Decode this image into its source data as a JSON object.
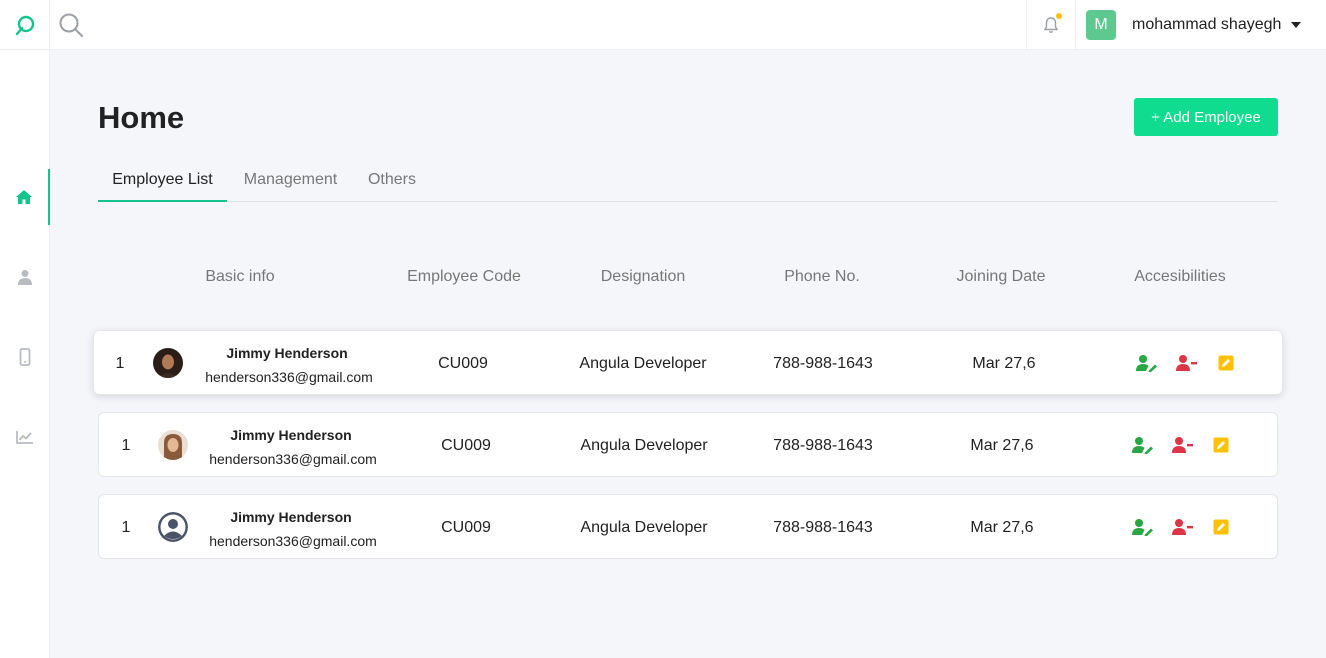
{
  "header": {
    "user": {
      "initial": "M",
      "name": "mohammad shayegh"
    }
  },
  "sidebar": {
    "items": [
      {
        "name": "home",
        "active": true
      },
      {
        "name": "user",
        "active": false
      },
      {
        "name": "mobile",
        "active": false
      },
      {
        "name": "chart",
        "active": false
      }
    ]
  },
  "main": {
    "title": "Home",
    "add_button": "+ Add Employee",
    "tabs": [
      {
        "label": "Employee List",
        "active": true
      },
      {
        "label": "Management",
        "active": false
      },
      {
        "label": "Others",
        "active": false
      }
    ],
    "columns": [
      "Basic info",
      "Employee Code",
      "Designation",
      "Phone No.",
      "Joining Date",
      "Accesibilities"
    ],
    "rows": [
      {
        "index": "1",
        "name": "Jimmy Henderson",
        "email": "henderson336@gmail.com",
        "code": "CU009",
        "designation": "Angula Developer",
        "phone": "788-988-1643",
        "date": "Mar 27,6",
        "avatar": "woman-dark-hair"
      },
      {
        "index": "1",
        "name": "Jimmy Henderson",
        "email": "henderson336@gmail.com",
        "code": "CU009",
        "designation": "Angula Developer",
        "phone": "788-988-1643",
        "date": "Mar 27,6",
        "avatar": "woman-light-hair"
      },
      {
        "index": "1",
        "name": "Jimmy Henderson",
        "email": "henderson336@gmail.com",
        "code": "CU009",
        "designation": "Angula Developer",
        "phone": "788-988-1643",
        "date": "Mar 27,6",
        "avatar": "default-user"
      }
    ]
  },
  "colors": {
    "accent": "#14c38e",
    "button": "#0fdc8f",
    "edit_user": "#28a745",
    "remove_user": "#dc3545",
    "edit": "#ffc107"
  }
}
